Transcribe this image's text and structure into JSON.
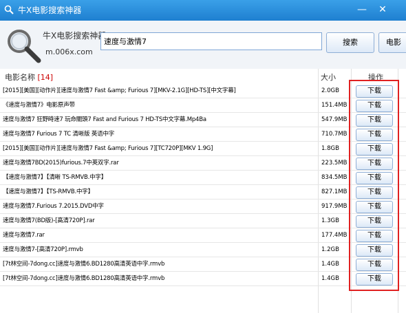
{
  "window": {
    "title": "牛X电影搜索神器",
    "minimize_glyph": "—",
    "close_glyph": "✕"
  },
  "brand": {
    "name": "牛X电影搜索神器",
    "url": "m.006x.com",
    "logo_icon": "magnifier-icon"
  },
  "search": {
    "value": "速度与激情7",
    "button_label": "搜索",
    "movie_button_label": "电影"
  },
  "table": {
    "headers": {
      "name": "电影名称",
      "count": "[14]",
      "size": "大小",
      "op": "操作"
    },
    "rows": [
      {
        "name": "[2015][美国][动作片][速度与激情7 Fast &amp; Furious 7][MKV-2.1G][HD-TS][中文字幕]",
        "size": "2.0GB",
        "action": "下载"
      },
      {
        "name": "《速度与激情7》电影原声带",
        "size": "151.4MB",
        "action": "下载"
      },
      {
        "name": "速度与激情7 狂野時速7 玩命關頭7 Fast and Furious 7 HD-TS中文字幕.Mp4Ba",
        "size": "547.9MB",
        "action": "下载"
      },
      {
        "name": "速度与激情7 Furious 7 TC 清晰版 英语中字",
        "size": "710.7MB",
        "action": "下载"
      },
      {
        "name": "[2015][美国][动作片][速度与激情7 Fast &amp; Furious 7][TC720P][MKV 1.9G]",
        "size": "1.8GB",
        "action": "下载"
      },
      {
        "name": "速度与激情7BD(2015)furious.7中英双字.rar",
        "size": "223.5MB",
        "action": "下载"
      },
      {
        "name": "【速度与激情7】【清晰 TS-RMVB.中字】",
        "size": "834.5MB",
        "action": "下载"
      },
      {
        "name": "【速度与激情7】【TS-RMVB.中字】",
        "size": "827.1MB",
        "action": "下载"
      },
      {
        "name": "速度与激情7.Furious 7.2015.DVD中字",
        "size": "917.9MB",
        "action": "下载"
      },
      {
        "name": "速度与激情7(BD版)-[高清720P].rar",
        "size": "1.3GB",
        "action": "下载"
      },
      {
        "name": "速度与激情7.rar",
        "size": "177.4MB",
        "action": "下载"
      },
      {
        "name": "速度与激情7-[高清720P].rmvb",
        "size": "1.2GB",
        "action": "下载"
      },
      {
        "name": "[7t林空间-7dong.cc]速度与激情6.BD1280高清英语中字.rmvb",
        "size": "1.4GB",
        "action": "下载"
      },
      {
        "name": "[7t林空间-7dong.cc]速度与激情6.BD1280高清英语中字.rmvb",
        "size": "1.4GB",
        "action": "下载"
      }
    ]
  },
  "colors": {
    "titlebar": "#1e7fd0",
    "highlight_box": "#e02020",
    "count": "#cc0000"
  }
}
